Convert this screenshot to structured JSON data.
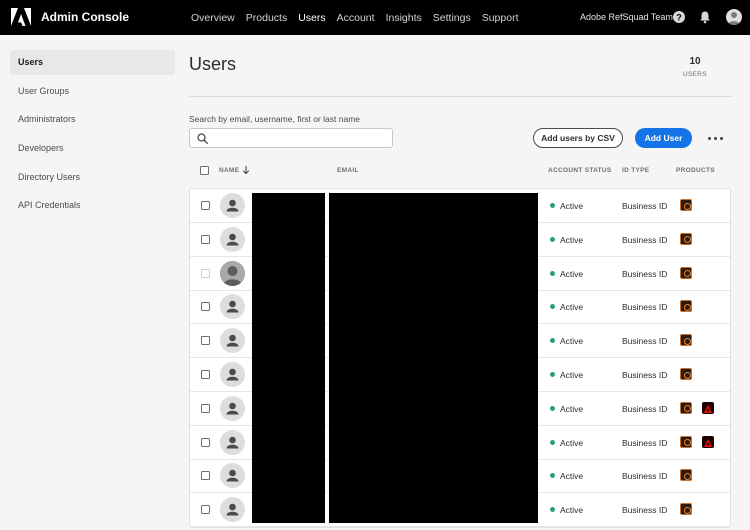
{
  "header": {
    "app_title": "Admin Console",
    "nav": [
      "Overview",
      "Products",
      "Users",
      "Account",
      "Insights",
      "Settings",
      "Support"
    ],
    "active_nav": "Users",
    "org_name": "Adobe RefSquad Team"
  },
  "sidebar": {
    "items": [
      {
        "label": "Users",
        "active": true
      },
      {
        "label": "User Groups",
        "active": false
      },
      {
        "label": "Administrators",
        "active": false
      },
      {
        "label": "Developers",
        "active": false
      },
      {
        "label": "Directory Users",
        "active": false
      },
      {
        "label": "API Credentials",
        "active": false
      }
    ]
  },
  "main": {
    "title": "Users",
    "user_count": "10",
    "user_count_label": "USERS",
    "search_label": "Search by email, username, first or last name",
    "search_value": "",
    "add_csv_label": "Add users by CSV",
    "add_user_label": "Add User"
  },
  "table": {
    "columns": {
      "name": "NAME",
      "email": "EMAIL",
      "status": "ACCOUNT STATUS",
      "id_type": "ID TYPE",
      "products": "PRODUCTS"
    },
    "rows": [
      {
        "status": "Active",
        "id_type": "Business ID",
        "photo": false,
        "checkbox_disabled": false,
        "products": [
          "product-icon"
        ]
      },
      {
        "status": "Active",
        "id_type": "Business ID",
        "photo": false,
        "checkbox_disabled": false,
        "products": [
          "product-icon"
        ]
      },
      {
        "status": "Active",
        "id_type": "Business ID",
        "photo": true,
        "checkbox_disabled": true,
        "products": [
          "product-icon"
        ]
      },
      {
        "status": "Active",
        "id_type": "Business ID",
        "photo": false,
        "checkbox_disabled": false,
        "products": [
          "product-icon"
        ]
      },
      {
        "status": "Active",
        "id_type": "Business ID",
        "photo": false,
        "checkbox_disabled": false,
        "products": [
          "product-icon"
        ]
      },
      {
        "status": "Active",
        "id_type": "Business ID",
        "photo": false,
        "checkbox_disabled": false,
        "products": [
          "product-icon"
        ]
      },
      {
        "status": "Active",
        "id_type": "Business ID",
        "photo": false,
        "checkbox_disabled": false,
        "products": [
          "product-icon",
          "acrobat-icon"
        ]
      },
      {
        "status": "Active",
        "id_type": "Business ID",
        "photo": false,
        "checkbox_disabled": false,
        "products": [
          "product-icon",
          "acrobat-icon"
        ]
      },
      {
        "status": "Active",
        "id_type": "Business ID",
        "photo": false,
        "checkbox_disabled": false,
        "products": [
          "product-icon"
        ]
      },
      {
        "status": "Active",
        "id_type": "Business ID",
        "photo": false,
        "checkbox_disabled": false,
        "products": [
          "product-icon"
        ]
      }
    ]
  },
  "colors": {
    "accent": "#1473e6",
    "status_active": "#2d9d78",
    "topbar": "#000000"
  }
}
